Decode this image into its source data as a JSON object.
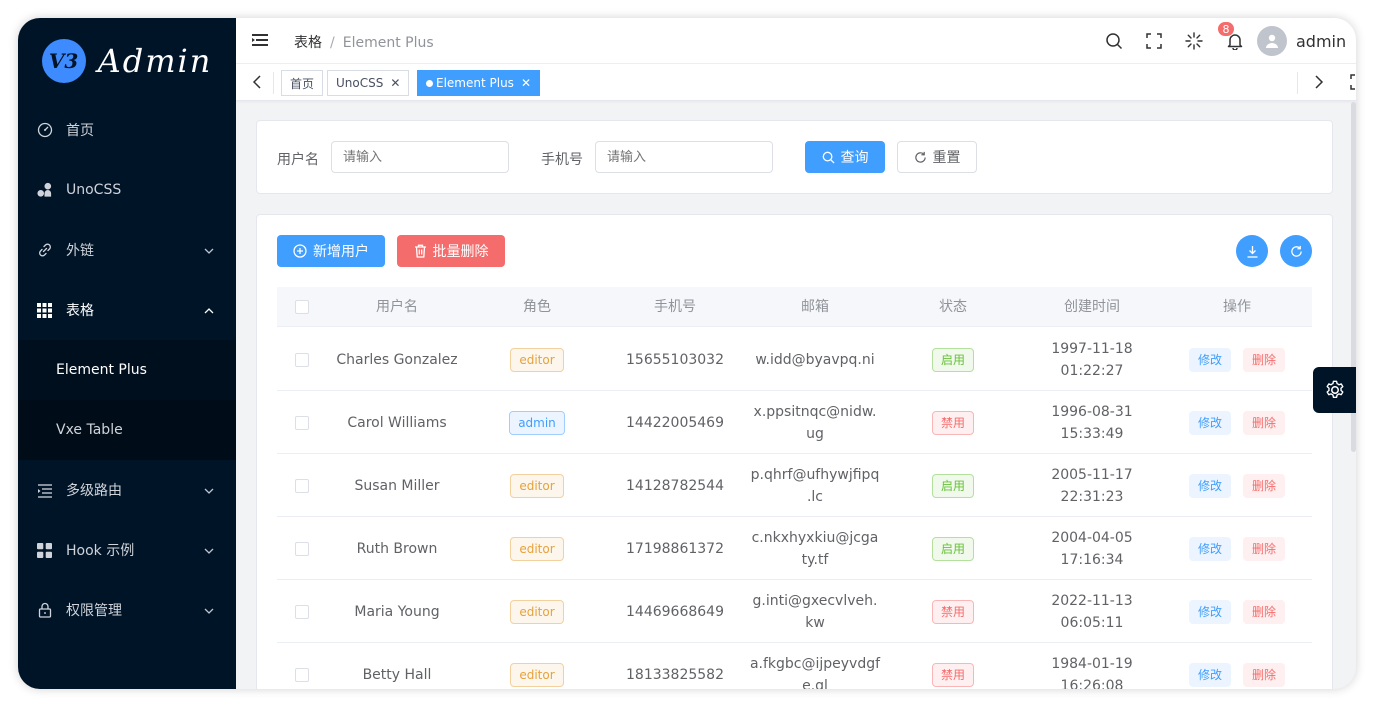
{
  "app": {
    "logo_badge": "V3",
    "logo_text": "Admin"
  },
  "sidebar": {
    "items": [
      {
        "label": "首页",
        "icon": "dashboard-icon"
      },
      {
        "label": "UnoCSS",
        "icon": "unocss-icon"
      },
      {
        "label": "外链",
        "icon": "link-icon",
        "chevron": "down"
      },
      {
        "label": "表格",
        "icon": "grid-icon",
        "chevron": "up"
      },
      {
        "label": "Element Plus",
        "sub": true,
        "active": true
      },
      {
        "label": "Vxe Table",
        "sub": true
      },
      {
        "label": "多级路由",
        "icon": "menu-list-icon",
        "chevron": "down"
      },
      {
        "label": "Hook 示例",
        "icon": "apps-icon",
        "chevron": "down"
      },
      {
        "label": "权限管理",
        "icon": "lock-icon",
        "chevron": "down"
      }
    ]
  },
  "header": {
    "breadcrumb": [
      "表格",
      "Element Plus"
    ],
    "notification_count": "8",
    "username": "admin"
  },
  "tags": [
    {
      "label": "首页"
    },
    {
      "label": "UnoCSS",
      "closable": true
    },
    {
      "label": "Element Plus",
      "closable": true,
      "active": true
    }
  ],
  "search": {
    "username_label": "用户名",
    "username_placeholder": "请输入",
    "phone_label": "手机号",
    "phone_placeholder": "请输入",
    "query_button": "查询",
    "reset_button": "重置"
  },
  "toolbar": {
    "add_button": "新增用户",
    "batch_delete_button": "批量删除"
  },
  "table": {
    "columns": [
      "用户名",
      "角色",
      "手机号",
      "邮箱",
      "状态",
      "创建时间",
      "操作"
    ],
    "edit_label": "修改",
    "delete_label": "删除",
    "rows": [
      {
        "username": "Charles Gonzalez",
        "role": "editor",
        "phone": "15655103032",
        "email": [
          "w.idd@byavpq.ni"
        ],
        "status": "启用",
        "status_type": "on",
        "created": [
          "1997-11-18",
          "01:22:27"
        ]
      },
      {
        "username": "Carol Williams",
        "role": "admin",
        "phone": "14422005469",
        "email": [
          "x.ppsitnqc@nidw.",
          "ug"
        ],
        "status": "禁用",
        "status_type": "off",
        "created": [
          "1996-08-31",
          "15:33:49"
        ]
      },
      {
        "username": "Susan Miller",
        "role": "editor",
        "phone": "14128782544",
        "email": [
          "p.qhrf@ufhywjfipq",
          ".lc"
        ],
        "status": "启用",
        "status_type": "on",
        "created": [
          "2005-11-17",
          "22:31:23"
        ]
      },
      {
        "username": "Ruth Brown",
        "role": "editor",
        "phone": "17198861372",
        "email": [
          "c.nkxhyxkiu@jcga",
          "ty.tf"
        ],
        "status": "启用",
        "status_type": "on",
        "created": [
          "2004-04-05",
          "17:16:34"
        ]
      },
      {
        "username": "Maria Young",
        "role": "editor",
        "phone": "14469668649",
        "email": [
          "g.inti@gxecvlveh.",
          "kw"
        ],
        "status": "禁用",
        "status_type": "off",
        "created": [
          "2022-11-13",
          "06:05:11"
        ]
      },
      {
        "username": "Betty Hall",
        "role": "editor",
        "phone": "18133825582",
        "email": [
          "a.fkgbc@ijpeyvdgf",
          "e.gl"
        ],
        "status": "禁用",
        "status_type": "off",
        "created": [
          "1984-01-19",
          "16:26:08"
        ]
      }
    ]
  },
  "colors": {
    "primary": "#409eff",
    "danger": "#f56c6c",
    "sidebar_bg": "#001428",
    "success": "#67c23a",
    "warning": "#e6a23c"
  }
}
